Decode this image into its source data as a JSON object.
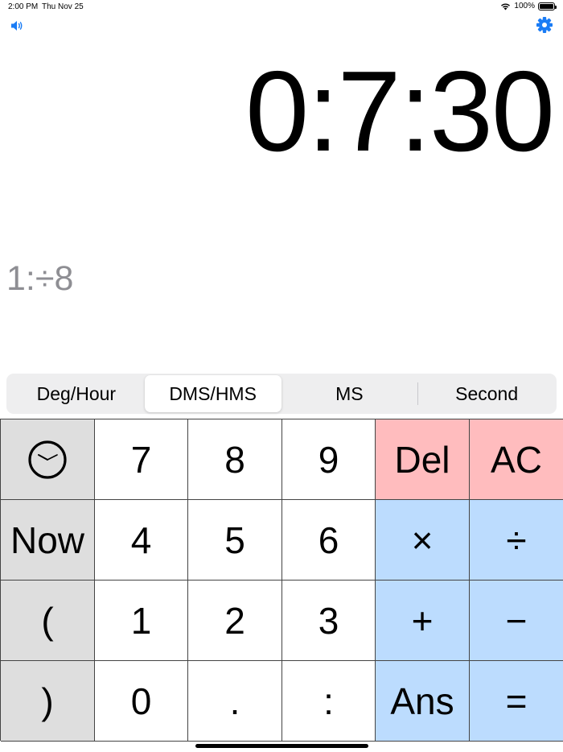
{
  "status_bar": {
    "time": "2:00 PM",
    "date": "Thu Nov 25",
    "battery": "100%"
  },
  "display": {
    "result": "0:7:30",
    "expression": "1:÷8"
  },
  "icons": {
    "sound": "speaker-icon",
    "settings": "gear-icon",
    "clock": "clock-icon"
  },
  "colors": {
    "accent": "#1a7cf5",
    "expression_text": "#8e8e93",
    "function_key": "#dedede",
    "delete_key": "#ffbcbe",
    "operator_key": "#bcdcfe"
  },
  "modes": {
    "items": [
      "Deg/Hour",
      "DMS/HMS",
      "MS",
      "Second"
    ],
    "selected": "DMS/HMS"
  },
  "keypad": {
    "row1": [
      "",
      "7",
      "8",
      "9",
      "Del",
      "AC"
    ],
    "row2": [
      "Now",
      "4",
      "5",
      "6",
      "×",
      "÷"
    ],
    "row3": [
      "(",
      "1",
      "2",
      "3",
      "+",
      "−"
    ],
    "row4": [
      ")",
      "0",
      ".",
      ":",
      "Ans",
      "="
    ]
  }
}
